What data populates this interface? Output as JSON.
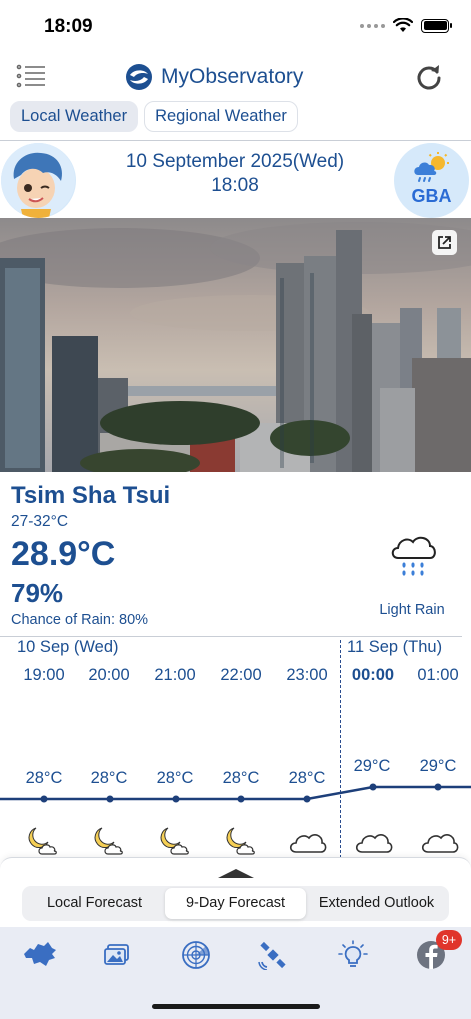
{
  "status_bar": {
    "time": "18:09"
  },
  "nav": {
    "title": "MyObservatory"
  },
  "top_tabs": [
    {
      "label": "Local Weather",
      "active": true
    },
    {
      "label": "Regional Weather",
      "active": false
    }
  ],
  "header": {
    "date": "10 September 2025(Wed)",
    "time": "18:08",
    "gba_label": "GBA"
  },
  "station": {
    "name": "Tsim Sha Tsui",
    "temp_range": "27-32°C",
    "current_temp": "28.9°C",
    "humidity": "79%",
    "rain_chance": "Chance of Rain: 80%",
    "weather_label": "Light Rain",
    "weather_icon": "rain-cloud-icon"
  },
  "hourly": {
    "days": [
      "10 Sep (Wed)",
      "11 Sep (Thu)"
    ],
    "hours": [
      {
        "time": "19:00",
        "temp": "28°C",
        "value": 28,
        "icon": "moon-cloud-icon"
      },
      {
        "time": "20:00",
        "temp": "28°C",
        "value": 28,
        "icon": "moon-cloud-icon"
      },
      {
        "time": "21:00",
        "temp": "28°C",
        "value": 28,
        "icon": "moon-cloud-icon"
      },
      {
        "time": "22:00",
        "temp": "28°C",
        "value": 28,
        "icon": "moon-cloud-icon"
      },
      {
        "time": "23:00",
        "temp": "28°C",
        "value": 28,
        "icon": "cloud-icon"
      },
      {
        "time": "00:00",
        "temp": "29°C",
        "value": 29,
        "icon": "cloud-icon"
      },
      {
        "time": "01:00",
        "temp": "29°C",
        "value": 29,
        "icon": "cloud-icon"
      }
    ]
  },
  "forecast_tabs": [
    {
      "label": "Local Forecast",
      "active": false
    },
    {
      "label": "9-Day Forecast",
      "active": true
    },
    {
      "label": "Extended Outlook",
      "active": false
    }
  ],
  "bottom_nav": {
    "items": [
      "map-icon",
      "photo-icon",
      "radar-icon",
      "satellite-icon",
      "lightbulb-icon",
      "facebook-icon"
    ],
    "badge": "9+"
  },
  "colors": {
    "brand": "#1d4f91",
    "badge": "#e0352b"
  }
}
